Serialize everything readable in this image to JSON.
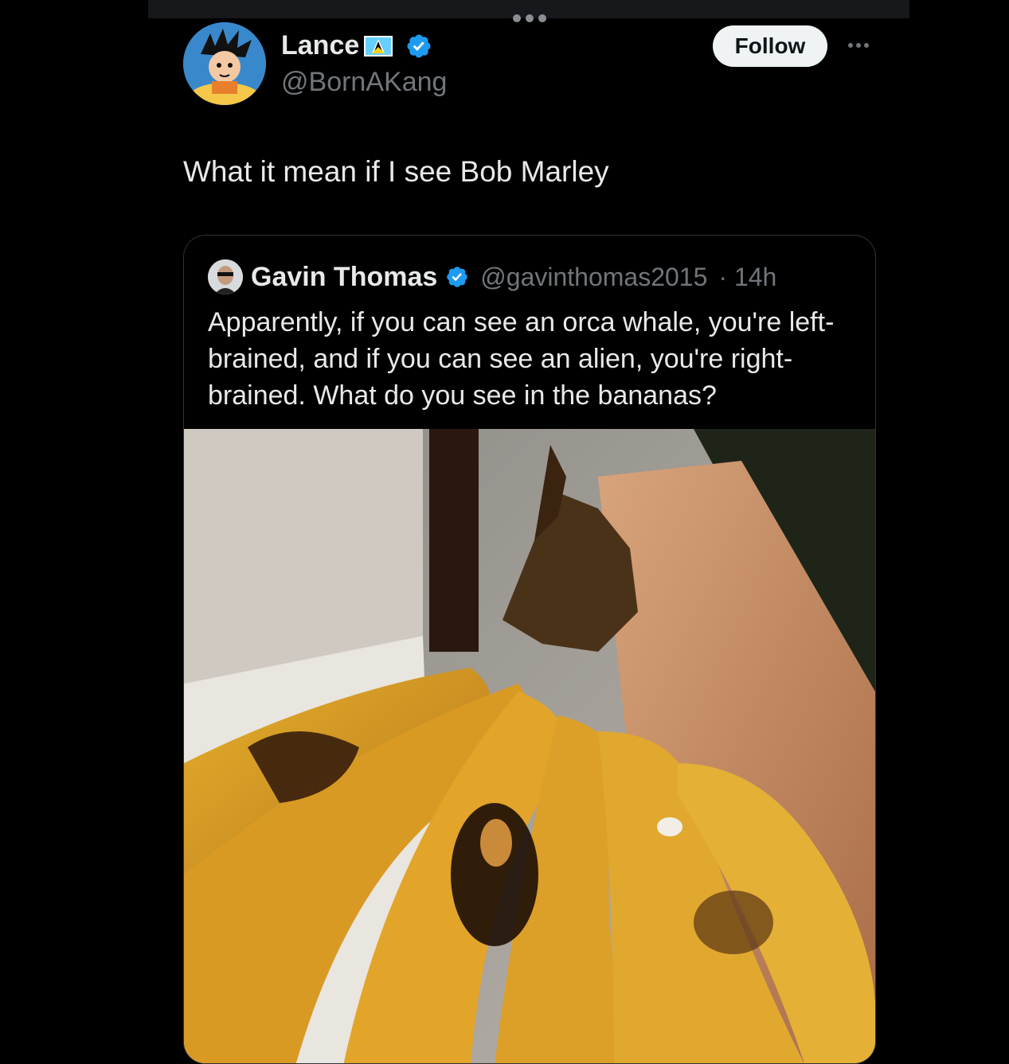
{
  "author": {
    "name": "Lance",
    "handle": "@BornAKang"
  },
  "follow_label": "Follow",
  "tweet_text": "What it mean if I see Bob Marley",
  "quoted": {
    "name": "Gavin Thomas",
    "handle": "@gavinthomas2015",
    "time": "· 14h",
    "text": "Apparently, if you can see an orca whale, you're left-brained, and if you can see an alien, you're right-brained. What do you see in the bananas?"
  },
  "icons": {
    "verified": "verified-badge-icon",
    "flag": "saint-lucia-flag-icon",
    "more": "more-options-icon"
  },
  "colors": {
    "background": "#000000",
    "text": "#e7e9ea",
    "secondary": "#71767b",
    "verified": "#1d9bf0",
    "follow_bg": "#eff3f4"
  }
}
